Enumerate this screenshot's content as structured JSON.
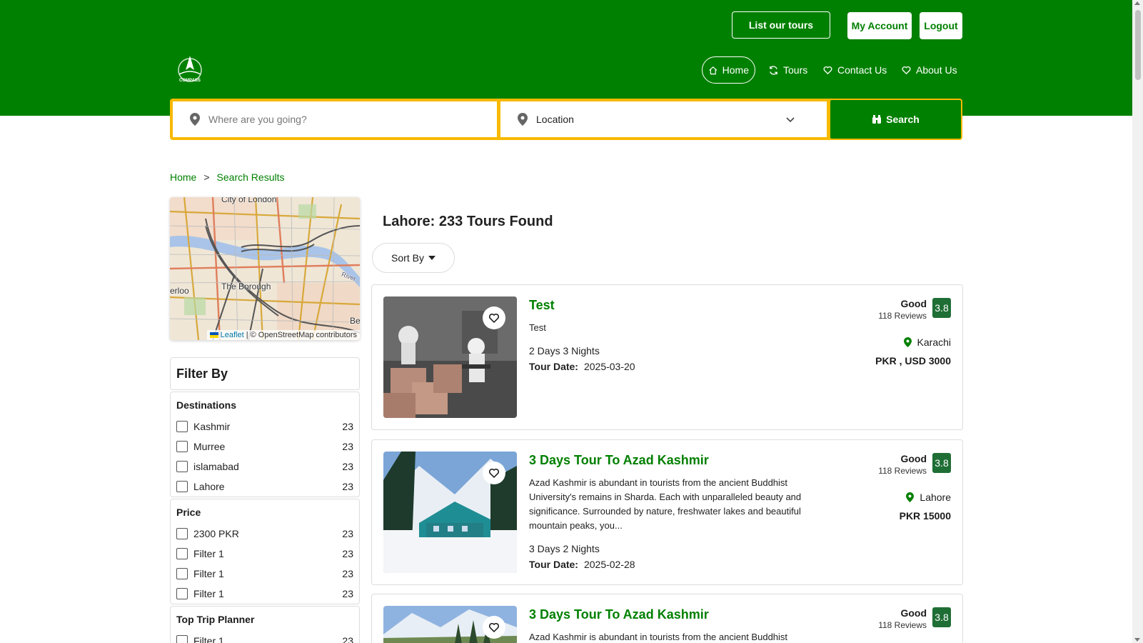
{
  "header": {
    "list_tours": "List our tours",
    "my_account": "My Account",
    "logout": "Logout",
    "logo_text": "COMPASS",
    "nav": {
      "home": "Home",
      "tours": "Tours",
      "contact": "Contact Us",
      "about": "About Us"
    },
    "colors": {
      "brand": "#008000",
      "accent": "#f7b900"
    }
  },
  "search": {
    "where_placeholder": "Where are you going?",
    "location_value": "Location",
    "search_label": "Search"
  },
  "breadcrumb": {
    "home": "Home",
    "separator": ">",
    "current": "Search Results"
  },
  "map": {
    "labels": {
      "city": "City of London",
      "borough": "The Borough",
      "left": "erloo",
      "right": "Be",
      "river": "River"
    },
    "attribution_leaflet": "Leaflet",
    "attribution_rest": "| © OpenStreetMap contributors"
  },
  "filters": {
    "title": "Filter By",
    "groups": [
      {
        "title": "Destinations",
        "items": [
          {
            "label": "Kashmir",
            "count": "23"
          },
          {
            "label": "Murree",
            "count": "23"
          },
          {
            "label": "islamabad",
            "count": "23"
          },
          {
            "label": "Lahore",
            "count": "23"
          }
        ]
      },
      {
        "title": "Price",
        "items": [
          {
            "label": "2300 PKR",
            "count": "23"
          },
          {
            "label": "Filter 1",
            "count": "23"
          },
          {
            "label": "Filter 1",
            "count": "23"
          },
          {
            "label": "Filter 1",
            "count": "23"
          }
        ]
      },
      {
        "title": "Top Trip Planner",
        "items": [
          {
            "label": "Filter 1",
            "count": "23"
          }
        ]
      }
    ]
  },
  "results": {
    "title": "Lahore: 233 Tours Found",
    "sort_label": "Sort By",
    "tours": [
      {
        "title": "Test",
        "description": "Test",
        "duration": "2 Days 3 Nights",
        "date_label": "Tour Date:",
        "date": "2025-03-20",
        "rating_word": "Good",
        "reviews": "118 Reviews",
        "score": "3.8",
        "location": "Karachi",
        "price": "PKR , USD 3000"
      },
      {
        "title": "3 Days Tour To Azad Kashmir",
        "description": "Azad Kashmir is abundant in tourists from the ancient Buddhist University's remains in Sharda. Each with unparalleled beauty and significance. Surrounded by nature, freshwater lakes and beautiful mountain peaks, you...",
        "duration": "3 Days 2 Nights",
        "date_label": "Tour Date:",
        "date": "2025-02-28",
        "rating_word": "Good",
        "reviews": "118 Reviews",
        "score": "3.8",
        "location": "Lahore",
        "price": "PKR 15000"
      },
      {
        "title": "3 Days Tour To Azad Kashmir",
        "description": "Azad Kashmir is abundant in tourists from the ancient Buddhist",
        "rating_word": "Good",
        "reviews": "118 Reviews",
        "score": "3.8"
      }
    ]
  }
}
